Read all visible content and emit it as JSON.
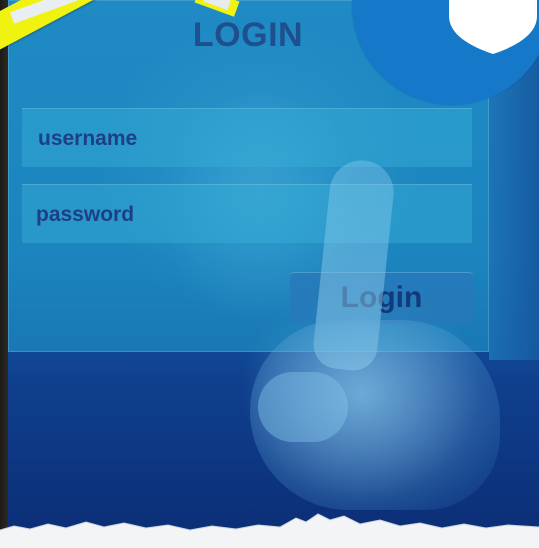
{
  "login_form": {
    "title": "LOGIN",
    "username_label": "username",
    "password_label": "password",
    "submit_label": "Login"
  },
  "colors": {
    "accent_blue": "#1678c9",
    "tape_yellow": "#f0f20f",
    "text_dark_blue": "#1d3f85"
  },
  "icons": [
    "shield-icon"
  ]
}
